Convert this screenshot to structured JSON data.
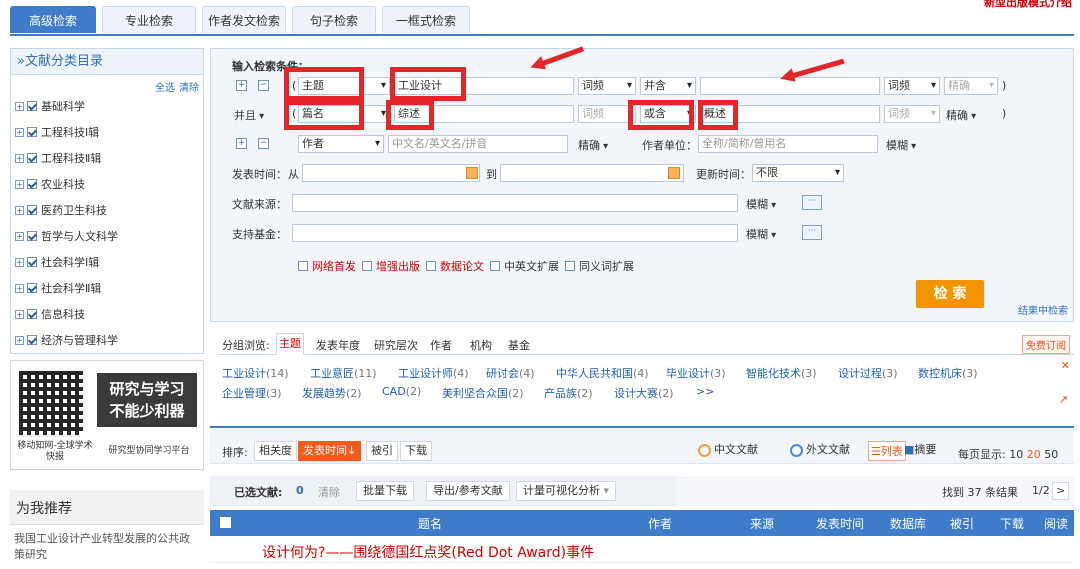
{
  "top_note": "新型出版模式介绍",
  "tabs": [
    "高级检索",
    "专业检索",
    "作者发文检索",
    "句子检索",
    "一框式检索"
  ],
  "sidebar": {
    "title": "»文献分类目录",
    "select_all": "全选",
    "clear": "清除",
    "categories": [
      "基础科学",
      "工程科技Ⅰ辑",
      "工程科技Ⅱ辑",
      "农业科技",
      "医药卫生科技",
      "哲学与人文科学",
      "社会科学Ⅰ辑",
      "社会科学Ⅱ辑",
      "信息科技",
      "经济与管理科学"
    ]
  },
  "promo": {
    "banner_line1": "研究与学习",
    "banner_line2": "不能少利器",
    "caption_left": "移动知网-全球学术快报",
    "caption_right": "研究型协同学习平台"
  },
  "recommend": {
    "title": "为我推荐",
    "item": "我国工业设计产业转型发展的公共政策研究"
  },
  "search": {
    "heading": "输入检索条件：",
    "row1": {
      "paren": "(",
      "field": "主题",
      "value": "工业设计",
      "freq": "词频",
      "logic": "并含",
      "value2": "",
      "freq2": "词频",
      "match": "精确",
      "close": ")"
    },
    "row2": {
      "and": "并且",
      "paren": "(",
      "field": "篇名",
      "value": "综述",
      "freq": "词频",
      "logic": "或含",
      "value2": "概述",
      "freq2": "词频",
      "match": "精确",
      "close": ")"
    },
    "row3": {
      "field": "作者",
      "placeholder": "中文名/英文名/拼音",
      "match": "精确",
      "unit_label": "作者单位：",
      "unit_placeholder": "全称/简称/曾用名",
      "unit_match": "模糊"
    },
    "date_label": "发表时间：",
    "date_from": "从",
    "date_to": "到",
    "update_label": "更新时间：",
    "update_value": "不限",
    "source_label": "文献来源：",
    "source_match": "模糊",
    "fund_label": "支持基金：",
    "fund_match": "模糊",
    "options": [
      "网络首发",
      "增强出版",
      "数据论文",
      "中英文扩展",
      "同义词扩展"
    ],
    "search_button": "检 索",
    "result_search": "结果中检索"
  },
  "group": {
    "label": "分组浏览:",
    "tabs": [
      "主题",
      "发表年度",
      "研究层次",
      "作者",
      "机构",
      "基金"
    ],
    "subscribe": "免费订阅",
    "items_row1": [
      {
        "name": "工业设计",
        "count": "(14)"
      },
      {
        "name": "工业意匠",
        "count": "(11)"
      },
      {
        "name": "工业设计师",
        "count": "(4)"
      },
      {
        "name": "研讨会",
        "count": "(4)"
      },
      {
        "name": "中华人民共和国",
        "count": "(4)"
      },
      {
        "name": "毕业设计",
        "count": "(3)"
      },
      {
        "name": "智能化技术",
        "count": "(3)"
      },
      {
        "name": "设计过程",
        "count": "(3)"
      },
      {
        "name": "数控机床",
        "count": "(3)"
      }
    ],
    "items_row2": [
      {
        "name": "企业管理",
        "count": "(3)"
      },
      {
        "name": "发展趋势",
        "count": "(2)"
      },
      {
        "name": "CAD",
        "count": "(2)"
      },
      {
        "name": "美利坚合众国",
        "count": "(2)"
      },
      {
        "name": "产品族",
        "count": "(2)"
      },
      {
        "name": "设计大赛",
        "count": "(2)"
      },
      {
        "name": ">>",
        "count": ""
      }
    ]
  },
  "sort": {
    "label": "排序:",
    "options": [
      "相关度",
      "发表时间↓",
      "被引",
      "下载"
    ],
    "chinese": "中文文献",
    "foreign": "外文文献",
    "list": "列表",
    "abstract": "摘要",
    "per_page_label": "每页显示:",
    "per_page": [
      "10",
      "20",
      "50"
    ]
  },
  "selection": {
    "label": "已选文献:",
    "count": "0",
    "clear": "清除",
    "batch": "批量下载",
    "export": "导出/参考文献",
    "visual": "计量可视化分析",
    "found": "找到 37 条结果",
    "page": "1/2",
    "next": ">"
  },
  "table": {
    "headers": [
      "题名",
      "作者",
      "来源",
      "发表时间",
      "数据库",
      "被引",
      "下载",
      "阅读"
    ],
    "first_row": "设计何为?——围绕德国红点奖(Red Dot Award)事件"
  },
  "colors": {
    "accent": "#3e7cc9",
    "annotation_red": "#e5252a",
    "search_orange": "#f29400",
    "sort_active": "#f35b1c"
  }
}
